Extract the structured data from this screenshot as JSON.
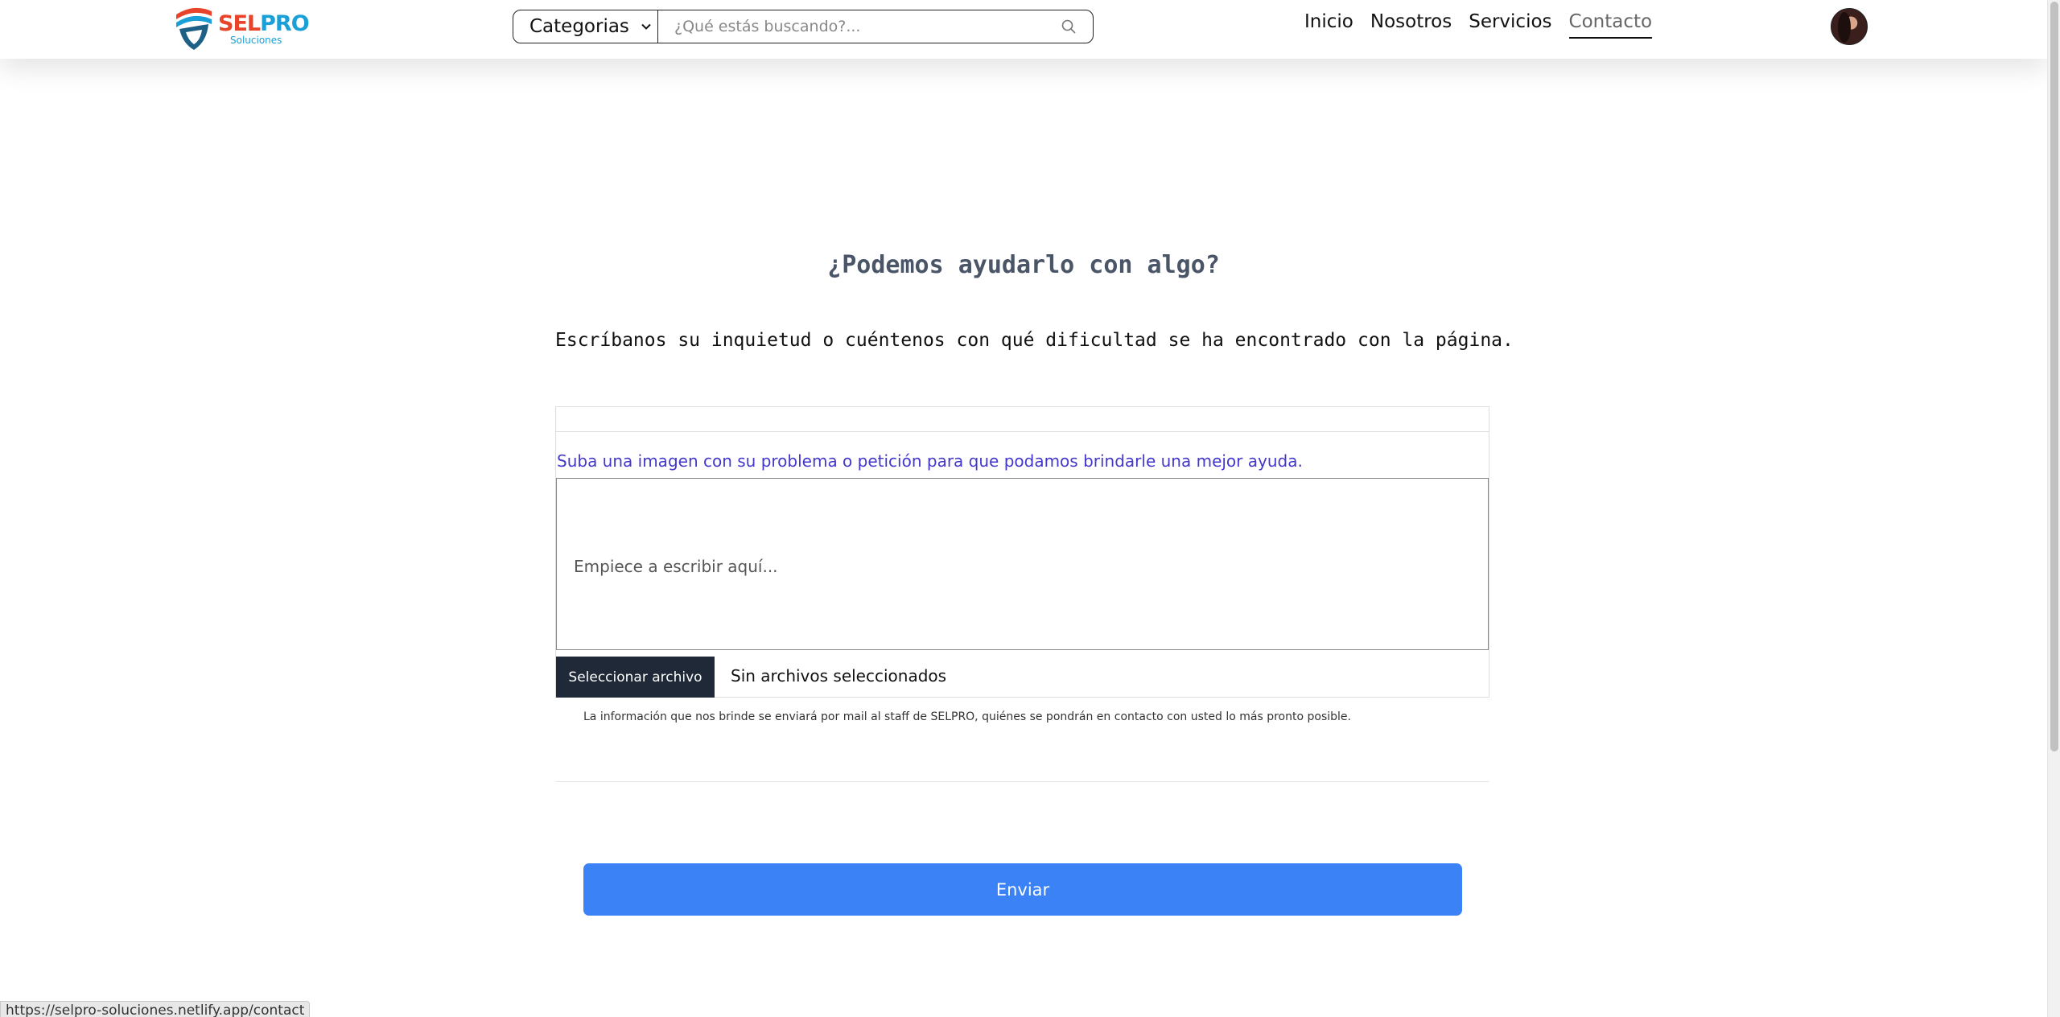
{
  "header": {
    "logo_brand_1": "SEL",
    "logo_brand_2": "PRO",
    "logo_sub": "Soluciones",
    "categories_label": "Categorias",
    "search_placeholder": "¿Qué estás buscando?...",
    "nav": [
      {
        "label": "Inicio"
      },
      {
        "label": "Nosotros"
      },
      {
        "label": "Servicios"
      },
      {
        "label": "Contacto",
        "active": true
      }
    ]
  },
  "content": {
    "title": "¿Podemos ayudarlo con algo?",
    "intro": "Escríbanos su inquietud o cuéntenos con qué dificultad se ha encontrado con la página.",
    "upload_hint": "Suba una imagen con su problema o petición para que podamos brindarle una mejor ayuda.",
    "message_placeholder": "Empiece a escribir aquí...",
    "file_button": "Seleccionar archivo",
    "file_status": "Sin archivos seleccionados",
    "disclaimer": "La información que nos brinde se enviará por mail al staff de SELPRO, quiénes se pondrán en contacto con usted lo más pronto posible.",
    "submit_label": "Enviar"
  },
  "status_bar": {
    "url": "https://selpro-soluciones.netlify.app/contact"
  },
  "colors": {
    "brand_red": "#e8432b",
    "brand_blue": "#1a9fd6",
    "hint_purple": "#4338ca",
    "submit_blue": "#3b82f6",
    "file_button_bg": "#1f2937"
  },
  "icons": [
    "shield-logo-icon",
    "chevron-down-icon",
    "search-icon"
  ]
}
